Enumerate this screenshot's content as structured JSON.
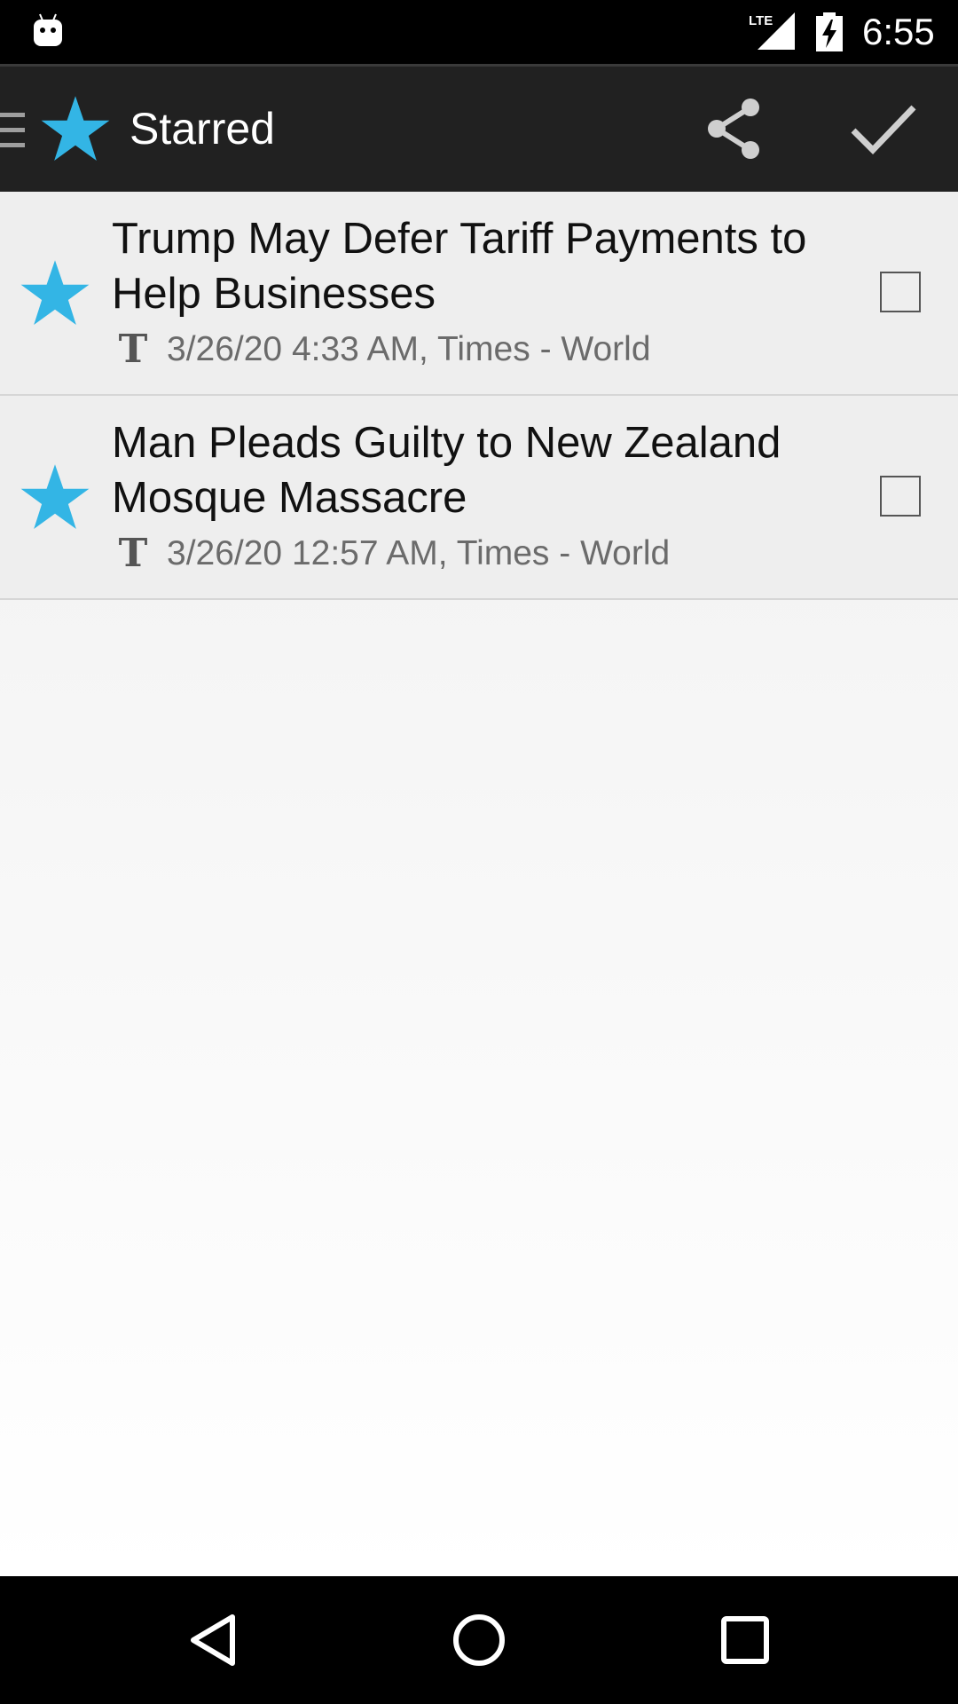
{
  "status_bar": {
    "network_label": "LTE",
    "clock": "6:55"
  },
  "action_bar": {
    "title": "Starred",
    "icons": [
      "menu-icon",
      "star-icon",
      "share-icon",
      "check-icon"
    ]
  },
  "articles": [
    {
      "headline": "Trump May Defer Tariff Payments to Help Businesses",
      "meta": "3/26/20 4:33 AM, Times - World",
      "source_icon": "T",
      "starred": true,
      "checked": false
    },
    {
      "headline": "Man Pleads Guilty to New Zealand Mosque Massacre",
      "meta": "3/26/20 12:57 AM, Times - World",
      "source_icon": "T",
      "starred": true,
      "checked": false
    }
  ],
  "colors": {
    "star": "#33b5e5",
    "action_bar": "#212121",
    "status_bar": "#000000"
  },
  "nav_bar": {
    "icons": [
      "back-icon",
      "home-icon",
      "recents-icon"
    ]
  }
}
